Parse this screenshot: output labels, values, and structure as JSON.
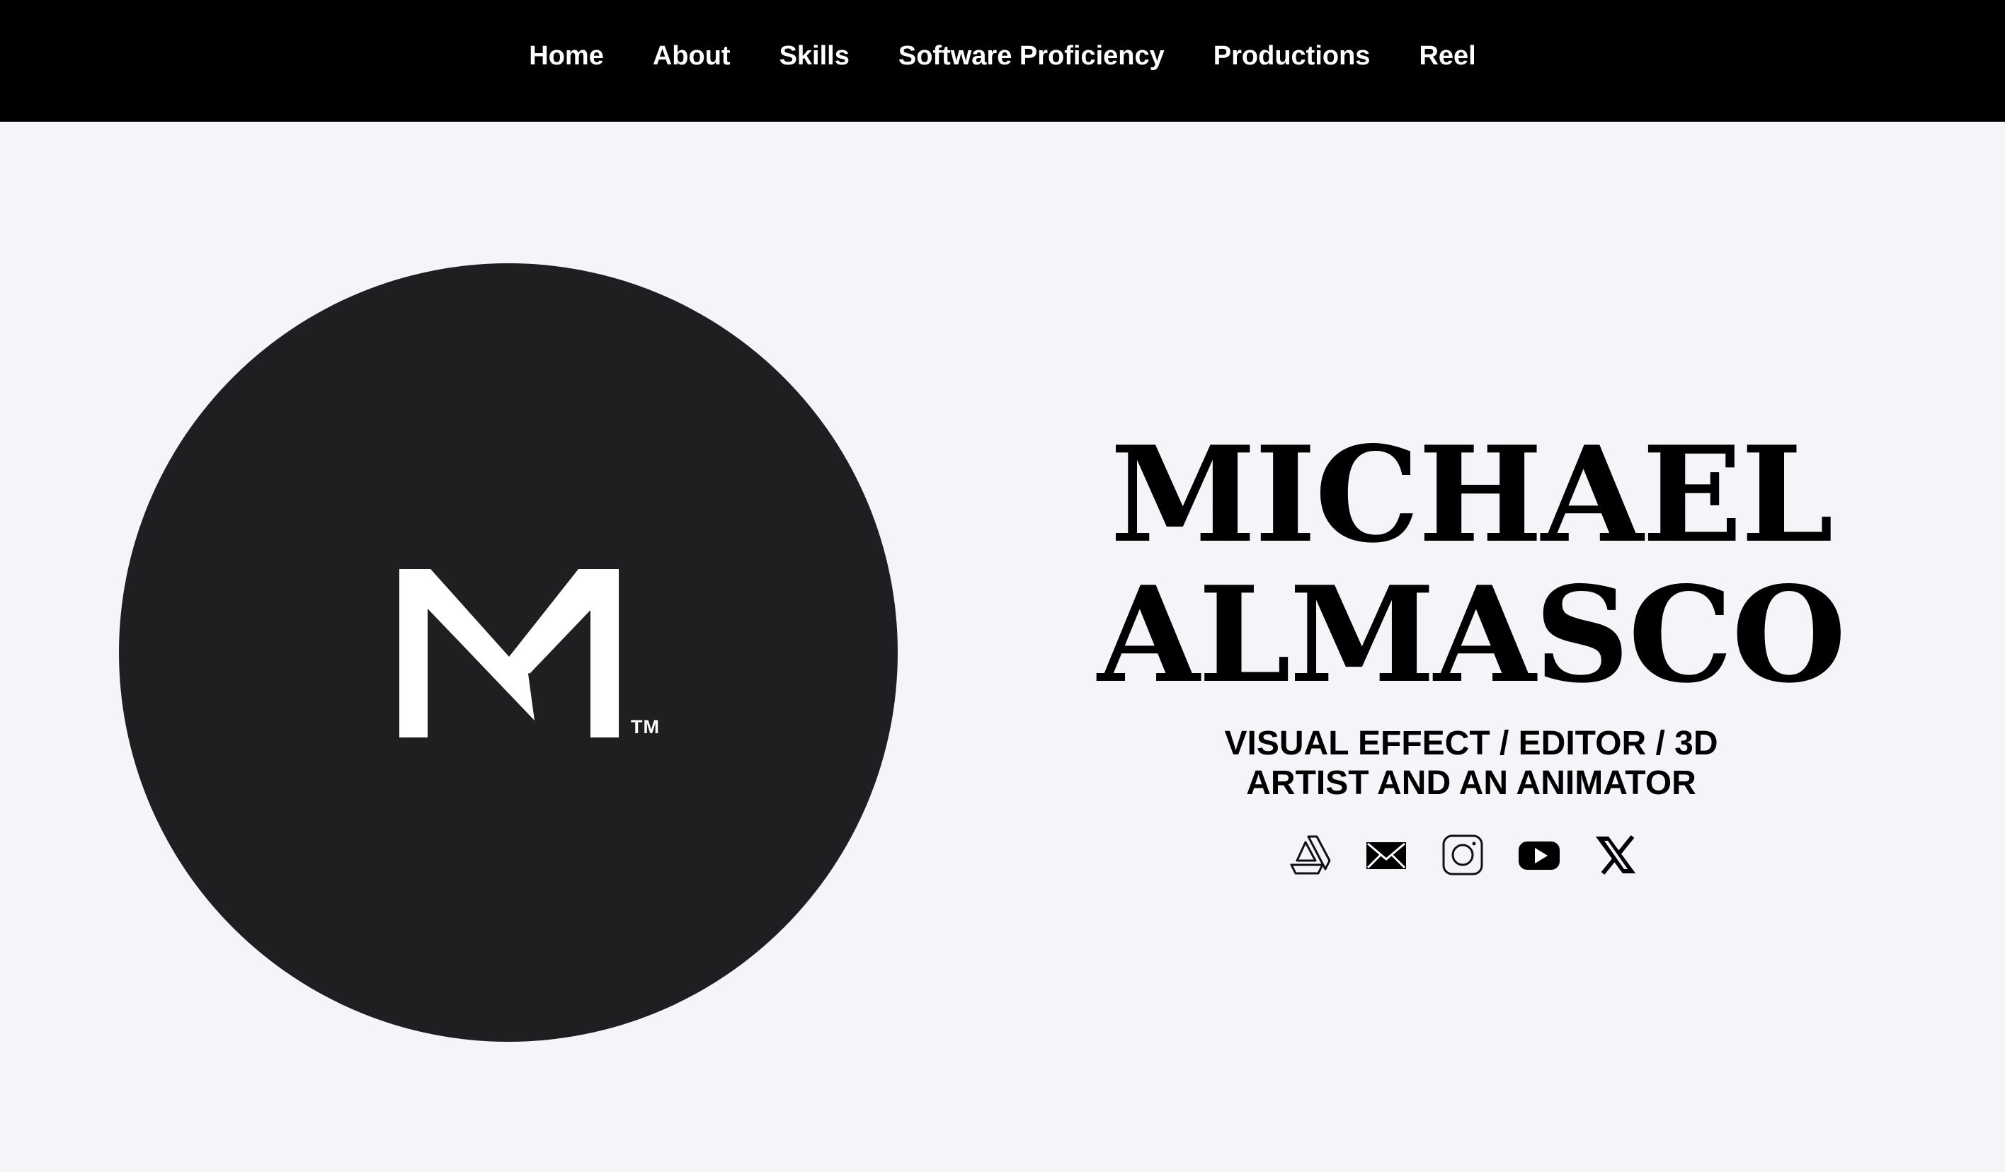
{
  "nav": {
    "items": [
      {
        "label": "Home"
      },
      {
        "label": "About"
      },
      {
        "label": "Skills"
      },
      {
        "label": "Software Proficiency"
      },
      {
        "label": "Productions"
      },
      {
        "label": "Reel"
      }
    ]
  },
  "logo": {
    "trademark": "TM"
  },
  "hero": {
    "name_line1": "MICHAEL",
    "name_line2": "ALMASCO",
    "subtitle_line1": "VISUAL EFFECT / EDITOR / 3D",
    "subtitle_line2": "ARTIST AND AN ANIMATOR"
  },
  "social": [
    {
      "icon": "artstation-icon"
    },
    {
      "icon": "mail-icon"
    },
    {
      "icon": "instagram-icon"
    },
    {
      "icon": "youtube-icon"
    },
    {
      "icon": "x-icon"
    }
  ],
  "colors": {
    "nav_background": "#000000",
    "page_background": "#f5f5f9",
    "logo_disc": "#1f1f22",
    "text": "#000000"
  }
}
